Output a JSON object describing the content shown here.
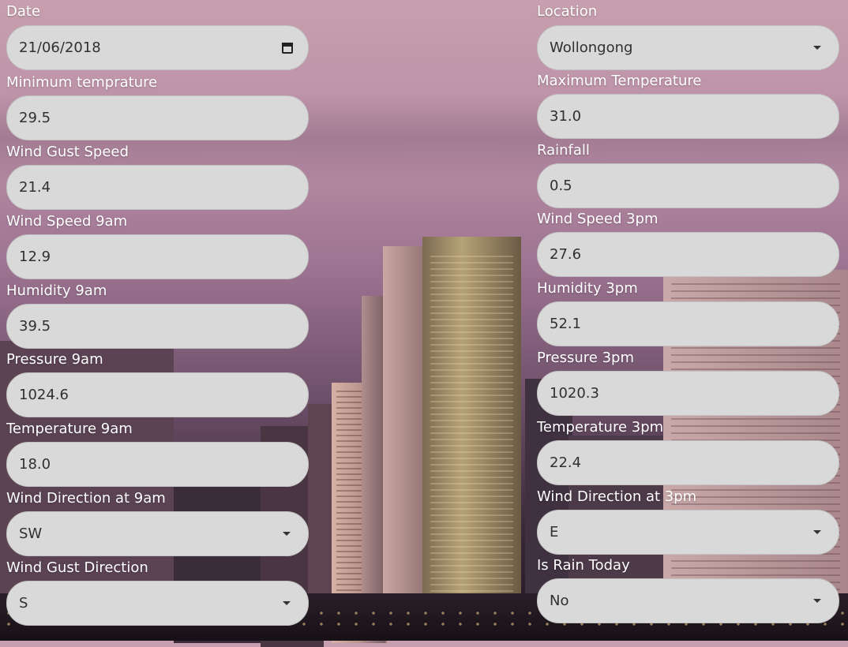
{
  "left": [
    {
      "label": "Date",
      "value": "21/06/2018",
      "kind": "date"
    },
    {
      "label": "Minimum temprature",
      "value": "29.5",
      "kind": "text"
    },
    {
      "label": "Wind Gust Speed",
      "value": "21.4",
      "kind": "text"
    },
    {
      "label": "Wind Speed 9am",
      "value": "12.9",
      "kind": "text"
    },
    {
      "label": "Humidity 9am",
      "value": "39.5",
      "kind": "text"
    },
    {
      "label": "Pressure 9am",
      "value": "1024.6",
      "kind": "text"
    },
    {
      "label": "Temperature 9am",
      "value": "18.0",
      "kind": "text"
    },
    {
      "label": "Wind Direction at 9am",
      "value": "SW",
      "kind": "select"
    },
    {
      "label": "Wind Gust Direction",
      "value": "S",
      "kind": "select"
    }
  ],
  "right": [
    {
      "label": "Location",
      "value": "Wollongong",
      "kind": "select"
    },
    {
      "label": "Maximum Temperature",
      "value": "31.0",
      "kind": "text"
    },
    {
      "label": "Rainfall",
      "value": "0.5",
      "kind": "text"
    },
    {
      "label": "Wind Speed 3pm",
      "value": "27.6",
      "kind": "text"
    },
    {
      "label": "Humidity 3pm",
      "value": "52.1",
      "kind": "text"
    },
    {
      "label": "Pressure 3pm",
      "value": "1020.3",
      "kind": "text"
    },
    {
      "label": "Temperature 3pm",
      "value": "22.4",
      "kind": "text"
    },
    {
      "label": "Wind Direction at 3pm",
      "value": "E",
      "kind": "select"
    },
    {
      "label": "Is Rain Today",
      "value": "No",
      "kind": "select"
    }
  ],
  "icons": {
    "calendar": "calendar-icon",
    "dropdown": "chevron-down-icon"
  }
}
